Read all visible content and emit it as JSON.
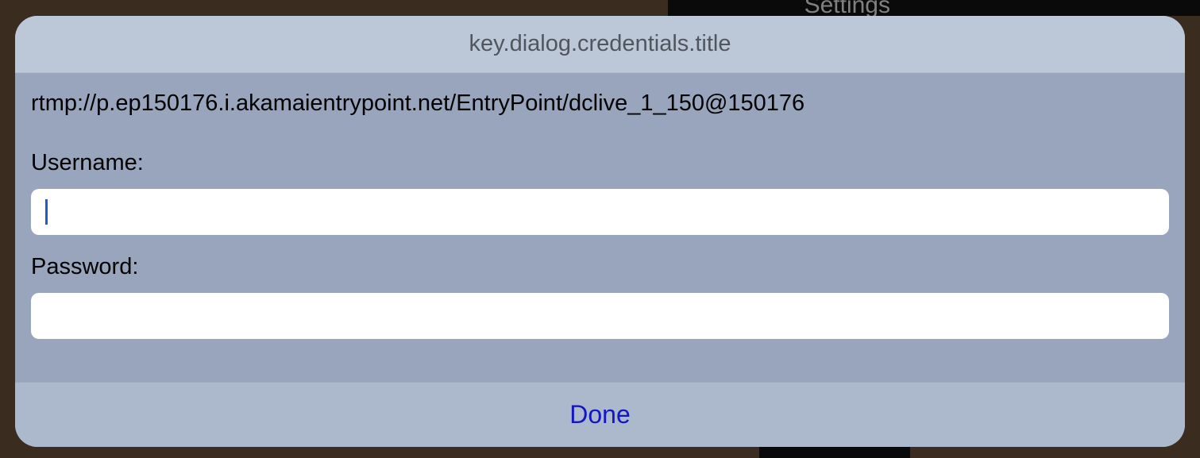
{
  "background": {
    "settings_label": "Settings"
  },
  "dialog": {
    "title": "key.dialog.credentials.title",
    "url": "rtmp://p.ep150176.i.akamaientrypoint.net/EntryPoint/dclive_1_150@150176",
    "username_label": "Username:",
    "username_value": "",
    "password_label": "Password:",
    "password_value": "",
    "done_label": "Done"
  }
}
